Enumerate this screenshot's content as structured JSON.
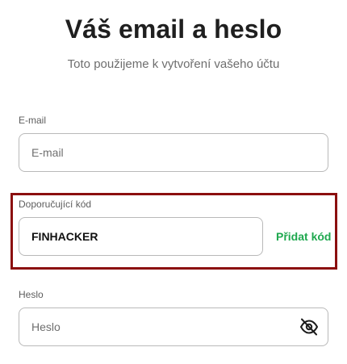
{
  "header": {
    "title": "Váš email a heslo",
    "subtitle": "Toto použijeme k vytvoření vašeho účtu"
  },
  "email": {
    "label": "E-mail",
    "placeholder": "E-mail",
    "value": ""
  },
  "referral": {
    "label": "Doporučující kód",
    "value": "FINHACKER",
    "add_label": "Přidat kód",
    "add_color": "#1fa84f",
    "highlight_color": "#8b0f0f"
  },
  "password": {
    "label": "Heslo",
    "placeholder": "Heslo",
    "value": "",
    "toggle_icon": "eye-off-icon"
  }
}
